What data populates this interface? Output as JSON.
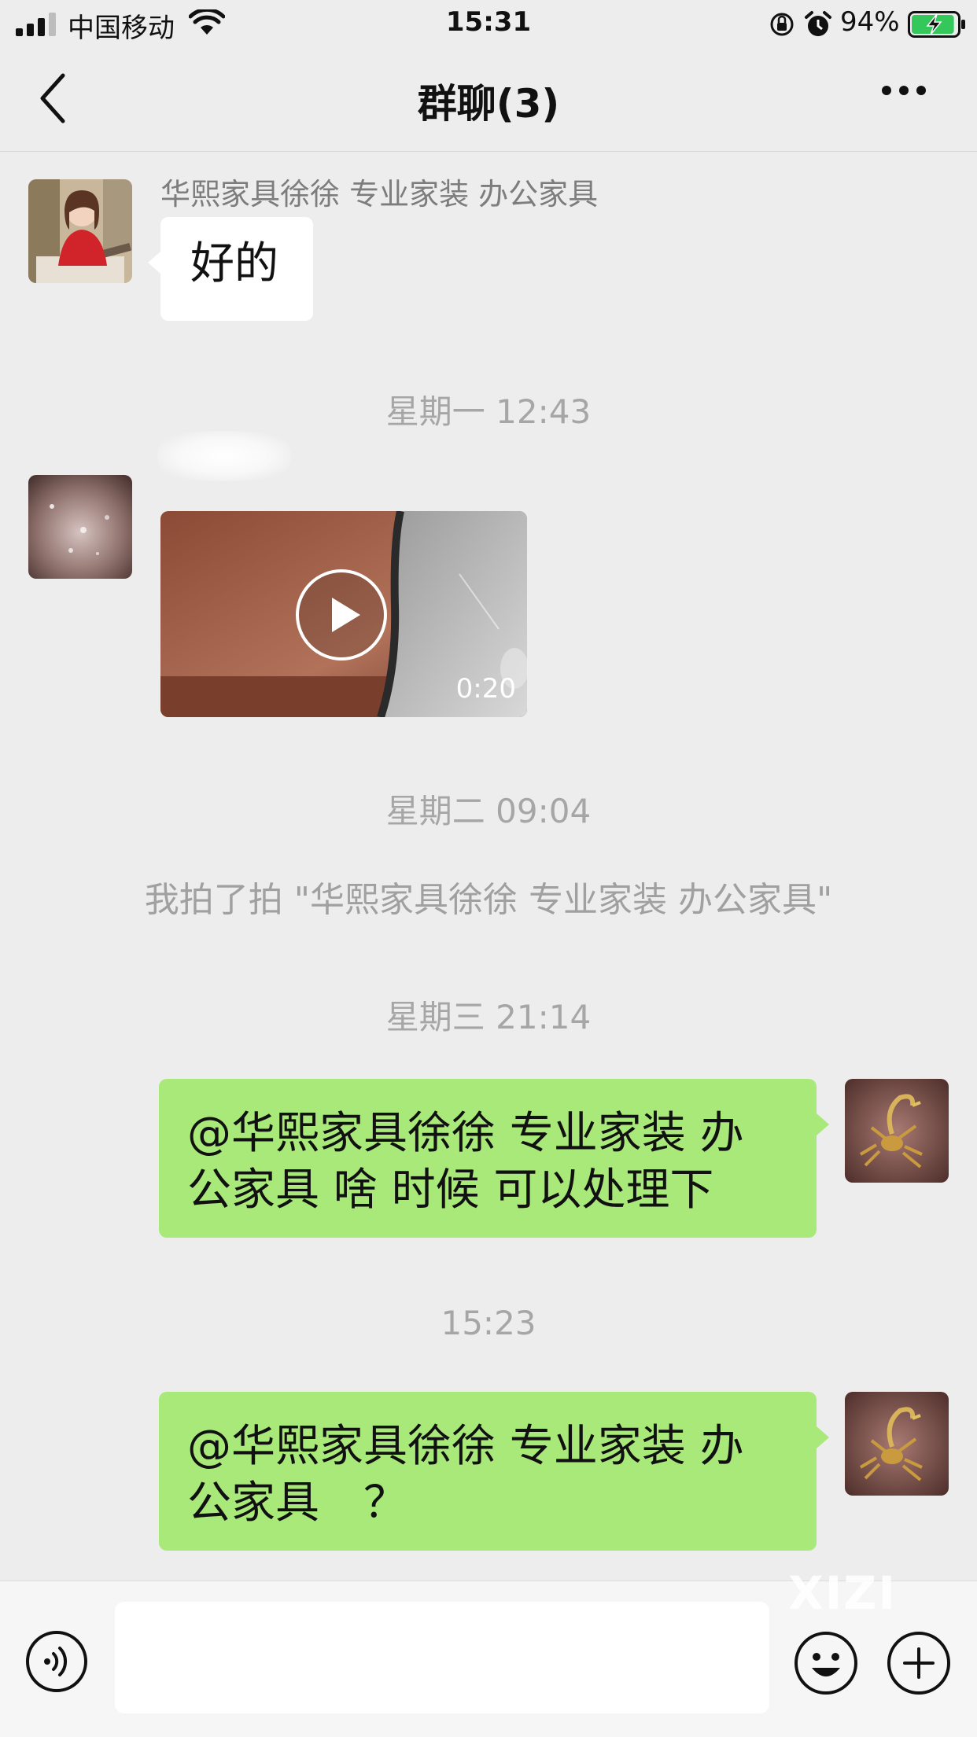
{
  "status_bar": {
    "carrier": "中国移动",
    "time": "15:31",
    "battery_percent": "94%",
    "battery_level": 0.94,
    "icons": [
      "signal-icon",
      "wifi-icon",
      "orientation-lock-icon",
      "alarm-icon",
      "battery-charging-icon"
    ]
  },
  "nav": {
    "title": "群聊(3)",
    "back_icon": "chevron-left-icon",
    "more_icon": "more-dots-icon"
  },
  "messages": [
    {
      "type": "text",
      "side": "left",
      "sender": "华熙家具徐徐 专业家装 办公家具",
      "text": "好的"
    },
    {
      "type": "timestamp",
      "text": "星期一 12:43"
    },
    {
      "type": "video",
      "side": "left",
      "duration": "0:20"
    },
    {
      "type": "timestamp",
      "text": "星期二 09:04"
    },
    {
      "type": "system",
      "text": "我拍了拍 \"华熙家具徐徐 专业家装 办公家具\""
    },
    {
      "type": "timestamp",
      "text": "星期三 21:14"
    },
    {
      "type": "text",
      "side": "right",
      "line1": "@华熙家具徐徐 专业家装 办",
      "line2": "公家具 啥 时候 可以处理下"
    },
    {
      "type": "timestamp",
      "text": "15:23"
    },
    {
      "type": "text",
      "side": "right",
      "line1": "@华熙家具徐徐 专业家装 办",
      "line2": "公家具　？"
    }
  ],
  "input_bar": {
    "placeholder": "",
    "icons": [
      "voice-icon",
      "emoji-icon",
      "plus-icon"
    ]
  },
  "watermark": "XIZI",
  "colors": {
    "background": "#ededed",
    "bubble_self": "#a9e97a",
    "bubble_other": "#ffffff",
    "battery_green": "#34c759"
  }
}
